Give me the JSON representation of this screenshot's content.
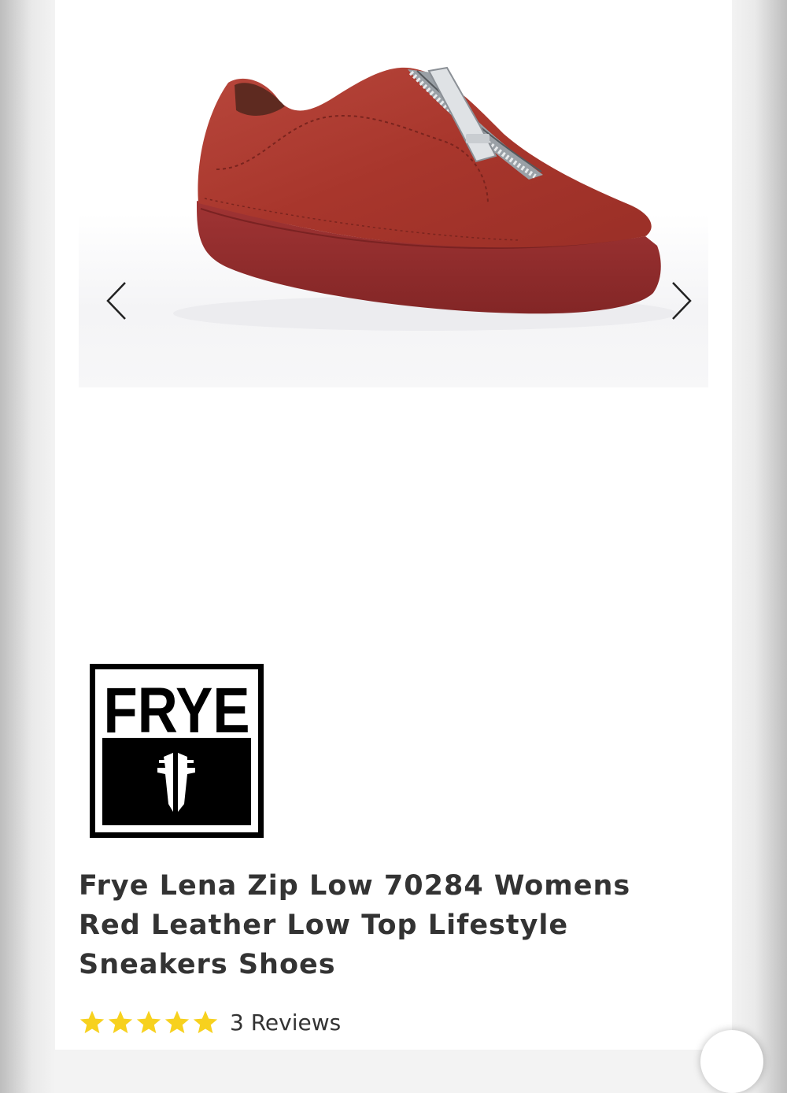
{
  "gallery": {
    "image_alt": "Red suede zip low sneaker",
    "prev_icon": "chevron-left-icon",
    "next_icon": "chevron-right-icon"
  },
  "brand": {
    "logo_text": "FRYE",
    "logo_icon": "frye-mark-icon"
  },
  "product": {
    "title": "Frye Lena Zip Low 70284 Womens Red Leather Low Top Lifestyle Sneakers Shoes",
    "rating_stars": 5,
    "rating_max": 5,
    "reviews_label": "3 Reviews"
  },
  "colors": {
    "star": "#f7d11e",
    "text": "#333333",
    "shoe": "#a8332a",
    "sole": "#8e2a2a"
  }
}
